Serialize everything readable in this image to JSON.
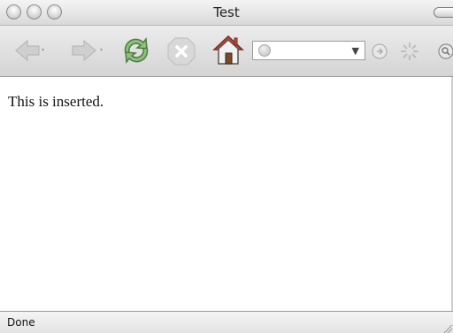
{
  "window": {
    "title": "Test"
  },
  "toolbar": {
    "back": "back-icon",
    "forward": "forward-icon",
    "reload": "reload-icon",
    "stop": "stop-icon",
    "home": "home-icon",
    "go": "go-icon",
    "throbber": "throbber-icon",
    "search": "search-icon",
    "address": {
      "value": "",
      "placeholder": ""
    }
  },
  "content": {
    "text": "This is inserted."
  },
  "status": {
    "text": "Done"
  },
  "colors": {
    "reload_green": "#4c9b3a",
    "home_red": "#b83a2a"
  }
}
